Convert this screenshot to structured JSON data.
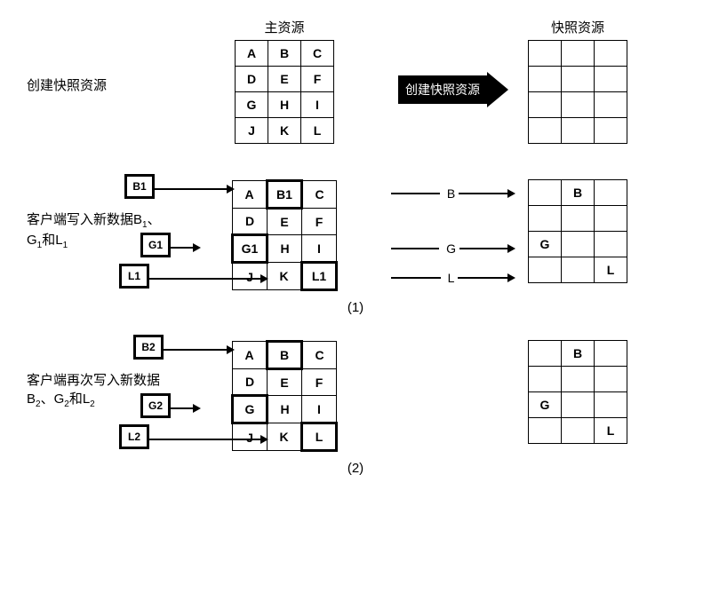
{
  "headers": {
    "main": "主资源",
    "snap": "快照资源"
  },
  "step1": {
    "label": "创建快照资源",
    "main_grid": [
      [
        "A",
        "B",
        "C"
      ],
      [
        "D",
        "E",
        "F"
      ],
      [
        "G",
        "H",
        "I"
      ],
      [
        "J",
        "K",
        "L"
      ]
    ],
    "arrow_text": "创建快照资源",
    "snap_grid": [
      [
        "",
        "",
        ""
      ],
      [
        "",
        "",
        ""
      ],
      [
        "",
        "",
        ""
      ],
      [
        "",
        "",
        ""
      ]
    ]
  },
  "step2": {
    "label_html": "客户端写入新数据B<sub>1</sub>、<br>G<sub>1</sub>和L<sub>1</sub>",
    "inputs": [
      "B1",
      "G1",
      "L1"
    ],
    "main_grid": [
      [
        "A",
        "B1",
        "C"
      ],
      [
        "D",
        "E",
        "F"
      ],
      [
        "G1",
        "H",
        "I"
      ],
      [
        "J",
        "K",
        "L1"
      ]
    ],
    "bold_cells": [
      [
        0,
        1
      ],
      [
        2,
        0
      ],
      [
        3,
        2
      ]
    ],
    "mid_labels": [
      "B",
      "G",
      "L"
    ],
    "snap_grid": [
      [
        "",
        "B",
        ""
      ],
      [
        "",
        "",
        ""
      ],
      [
        "G",
        "",
        ""
      ],
      [
        "",
        "",
        "L"
      ]
    ]
  },
  "step3": {
    "label_html": "客户端再次写入新数据<br>B<sub>2</sub>、G<sub>2</sub>和L<sub>2</sub>",
    "inputs": [
      "B2",
      "G2",
      "L2"
    ],
    "main_grid": [
      [
        "A",
        "B",
        "C"
      ],
      [
        "D",
        "E",
        "F"
      ],
      [
        "G",
        "H",
        "I"
      ],
      [
        "J",
        "K",
        "L"
      ]
    ],
    "bold_cells": [
      [
        0,
        1
      ],
      [
        2,
        0
      ],
      [
        3,
        2
      ]
    ],
    "snap_grid": [
      [
        "",
        "B",
        ""
      ],
      [
        "",
        "",
        ""
      ],
      [
        "G",
        "",
        ""
      ],
      [
        "",
        "",
        "L"
      ]
    ]
  },
  "fig_labels": {
    "one": "(1)",
    "two": "(2)"
  }
}
